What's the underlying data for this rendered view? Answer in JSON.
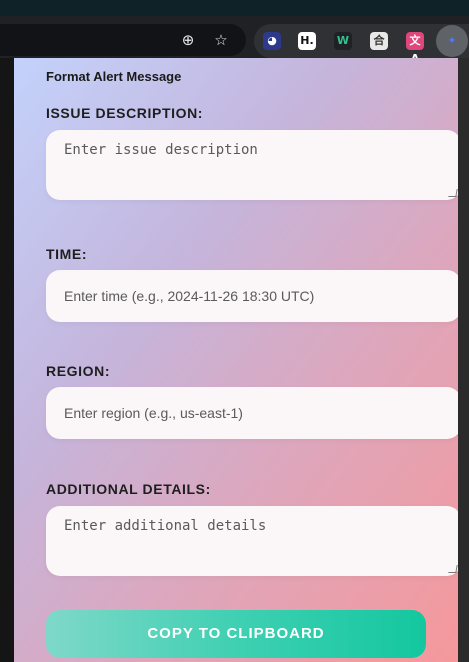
{
  "browser": {
    "zoom_icon": "zoom-icon",
    "bookmark_icon": "star-icon",
    "extensions": [
      {
        "name": "face-extension-icon",
        "glyph": "◕",
        "bg": "#2d3a8c",
        "fg": "#ffffff"
      },
      {
        "name": "h-extension-icon",
        "glyph": "H.",
        "bg": "#ffffff",
        "fg": "#111111"
      },
      {
        "name": "w-extension-icon",
        "glyph": "W",
        "bg": "#1f2124",
        "fg": "#34c38f"
      },
      {
        "name": "kanji-extension-icon",
        "glyph": "合",
        "bg": "#e8e8e8",
        "fg": "#333333"
      },
      {
        "name": "translate-extension-icon",
        "glyph": "文A",
        "bg": "#e0457b",
        "fg": "#ffffff"
      },
      {
        "name": "puzzle-extension-icon",
        "glyph": "✦",
        "bg": "#5f6368",
        "fg": "#4a7bf7"
      }
    ]
  },
  "popup": {
    "title": "Format Alert Message",
    "fields": {
      "issue": {
        "label": "ISSUE DESCRIPTION:",
        "placeholder": "Enter issue description",
        "value": ""
      },
      "time": {
        "label": "TIME:",
        "placeholder": "Enter time (e.g., 2024-11-26 18:30 UTC)",
        "value": ""
      },
      "region": {
        "label": "REGION:",
        "placeholder": "Enter region (e.g., us-east-1)",
        "value": ""
      },
      "details": {
        "label": "ADDITIONAL DETAILS:",
        "placeholder": "Enter additional details",
        "value": ""
      }
    },
    "copy_button": "COPY TO CLIPBOARD"
  },
  "colors": {
    "button_start": "#7fd8c9",
    "button_end": "#13c79f",
    "gradient_start": "#c3d2fb",
    "gradient_end": "#f5989b"
  }
}
